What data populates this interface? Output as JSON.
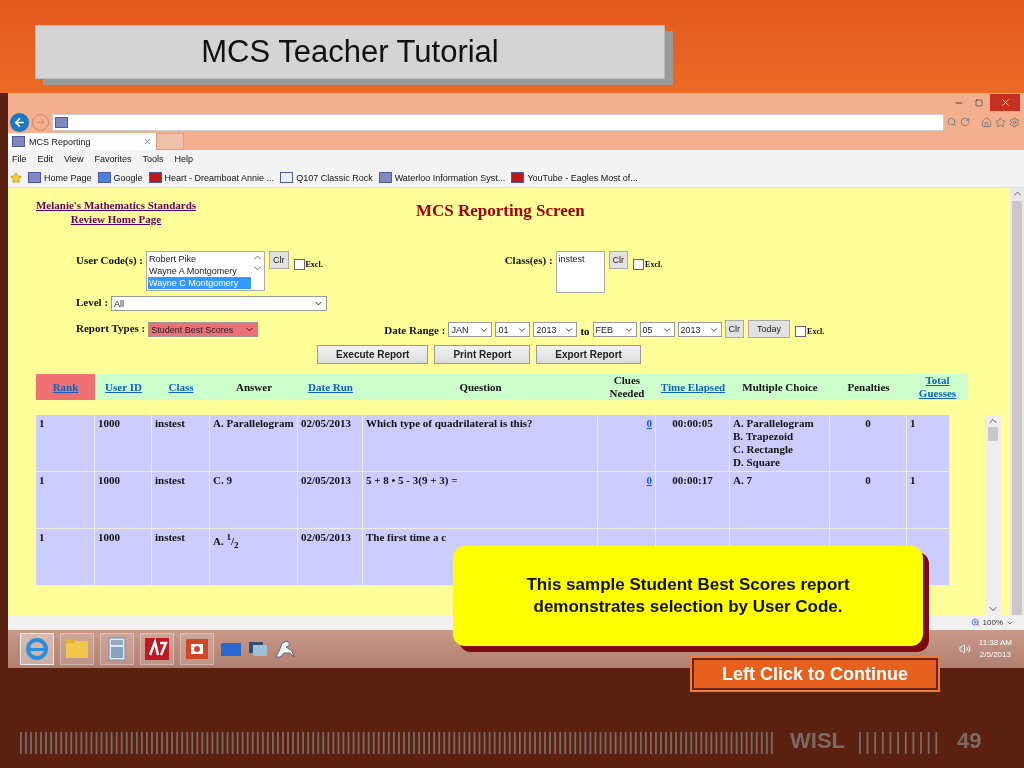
{
  "slide": {
    "title": "MCS Teacher Tutorial",
    "brand": "WISL",
    "page_number": "49"
  },
  "browser": {
    "tabs": [
      {
        "label": "MCS Reporting",
        "selected": true
      }
    ],
    "menu": [
      "File",
      "Edit",
      "View",
      "Favorites",
      "Tools",
      "Help"
    ],
    "favorites": [
      {
        "label": "Home Page",
        "kind": "site"
      },
      {
        "label": "Google",
        "kind": "google"
      },
      {
        "label": "Heart - Dreamboat Annie ...",
        "kind": "video"
      },
      {
        "label": "Q107 Classic Rock",
        "kind": "page"
      },
      {
        "label": "Waterloo Information Syst...",
        "kind": "site"
      },
      {
        "label": "YouTube - Eagles Most of...",
        "kind": "video"
      }
    ],
    "zoom": "100%"
  },
  "page": {
    "home_link": [
      "Melanie's Mathematics Standards",
      "Review Home Page"
    ],
    "title": "MCS Reporting Screen",
    "user_codes": {
      "label": "User Code(s) :",
      "options": [
        {
          "label": "Robert Pike",
          "selected": false
        },
        {
          "label": "Wayne A Montgomery",
          "selected": false
        },
        {
          "label": "Wayne C Montgomery",
          "selected": true
        }
      ],
      "clear": "Clr",
      "exclude": {
        "label": "Excl.",
        "checked": false
      }
    },
    "classes": {
      "label": "Class(es) :",
      "options": [
        {
          "label": "instest",
          "selected": false
        }
      ],
      "clear": "Clr",
      "exclude": {
        "label": "Excl.",
        "checked": false
      }
    },
    "level": {
      "label": "Level :",
      "value": "All"
    },
    "report_types": {
      "label": "Report Types :",
      "value": "Student Best Scores"
    },
    "date_range": {
      "label": "Date Range :",
      "from": [
        "JAN",
        "01",
        "2013"
      ],
      "joiner": "to",
      "to": [
        "FEB",
        "05",
        "2013"
      ],
      "clear": "Clr",
      "today": "Today",
      "exclude": {
        "label": "Excl.",
        "checked": false
      }
    },
    "actions": [
      "Execute Report",
      "Print Report",
      "Export Report"
    ],
    "table": {
      "columns": [
        {
          "label": "Rank",
          "link": true,
          "selected": true
        },
        {
          "label": "User ID",
          "link": true,
          "selected": false
        },
        {
          "label": "Class",
          "link": true,
          "selected": false
        },
        {
          "label": "Answer",
          "link": false,
          "selected": false
        },
        {
          "label": "Date Run",
          "link": true,
          "selected": false
        },
        {
          "label": "Question",
          "link": false,
          "selected": false
        },
        {
          "label": "Clues Needed",
          "link": false,
          "selected": false
        },
        {
          "label": "Time Elapsed",
          "link": true,
          "selected": false
        },
        {
          "label": "Multiple Choice",
          "link": false,
          "selected": false
        },
        {
          "label": "Penalties",
          "link": false,
          "selected": false
        },
        {
          "label": "Total Guesses",
          "link": true,
          "selected": false
        }
      ],
      "rows": [
        {
          "cells": [
            "1",
            "1000",
            "instest",
            "A. Parallelogram",
            "02/05/2013",
            "Which type of quadrilateral is this?",
            "0",
            "00:00:05",
            "A. Parallelogram\nB. Trapezoid\nC. Rectangle\nD. Square",
            "0",
            "1"
          ]
        },
        {
          "cells": [
            "1",
            "1000",
            "instest",
            "C. 9",
            "02/05/2013",
            "5 + 8 • 5 - 3(9 + 3) =",
            "0",
            "00:00:17",
            "A. 7",
            "0",
            "1"
          ]
        },
        {
          "cells": [
            "1",
            "1000",
            "instest",
            "A. $^{1}$/$_{2}$",
            "02/05/2013",
            "The first time a c"
          ]
        }
      ]
    }
  },
  "callout": {
    "text": "This sample Student Best Scores report demonstrates selection by User Code.",
    "button": "Left Click to Continue"
  },
  "taskbar": {
    "apps": [
      {
        "kind": "browser",
        "selected": true
      },
      {
        "kind": "folder",
        "selected": false
      },
      {
        "kind": "calculator",
        "selected": false
      },
      {
        "kind": "at7",
        "selected": false
      },
      {
        "kind": "slides",
        "selected": false
      }
    ],
    "time": "11:38 AM",
    "date": "2/5/2013"
  }
}
